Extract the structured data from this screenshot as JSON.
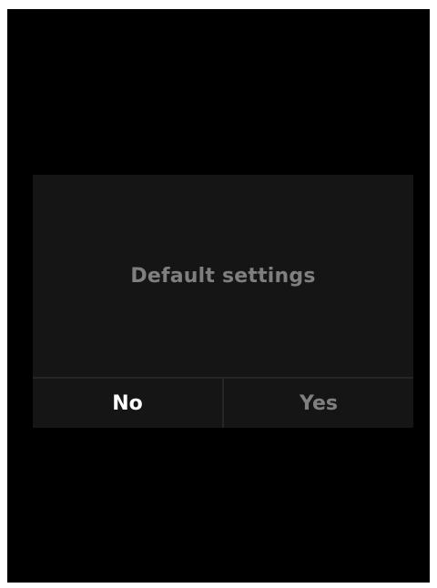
{
  "dialog": {
    "message": "Default settings",
    "buttons": {
      "no_label": "No",
      "yes_label": "Yes"
    }
  },
  "colors": {
    "screen_background": "#000000",
    "dialog_background": "#151515",
    "selected_text": "#ffffff",
    "unselected_text": "#7f7f7f"
  }
}
